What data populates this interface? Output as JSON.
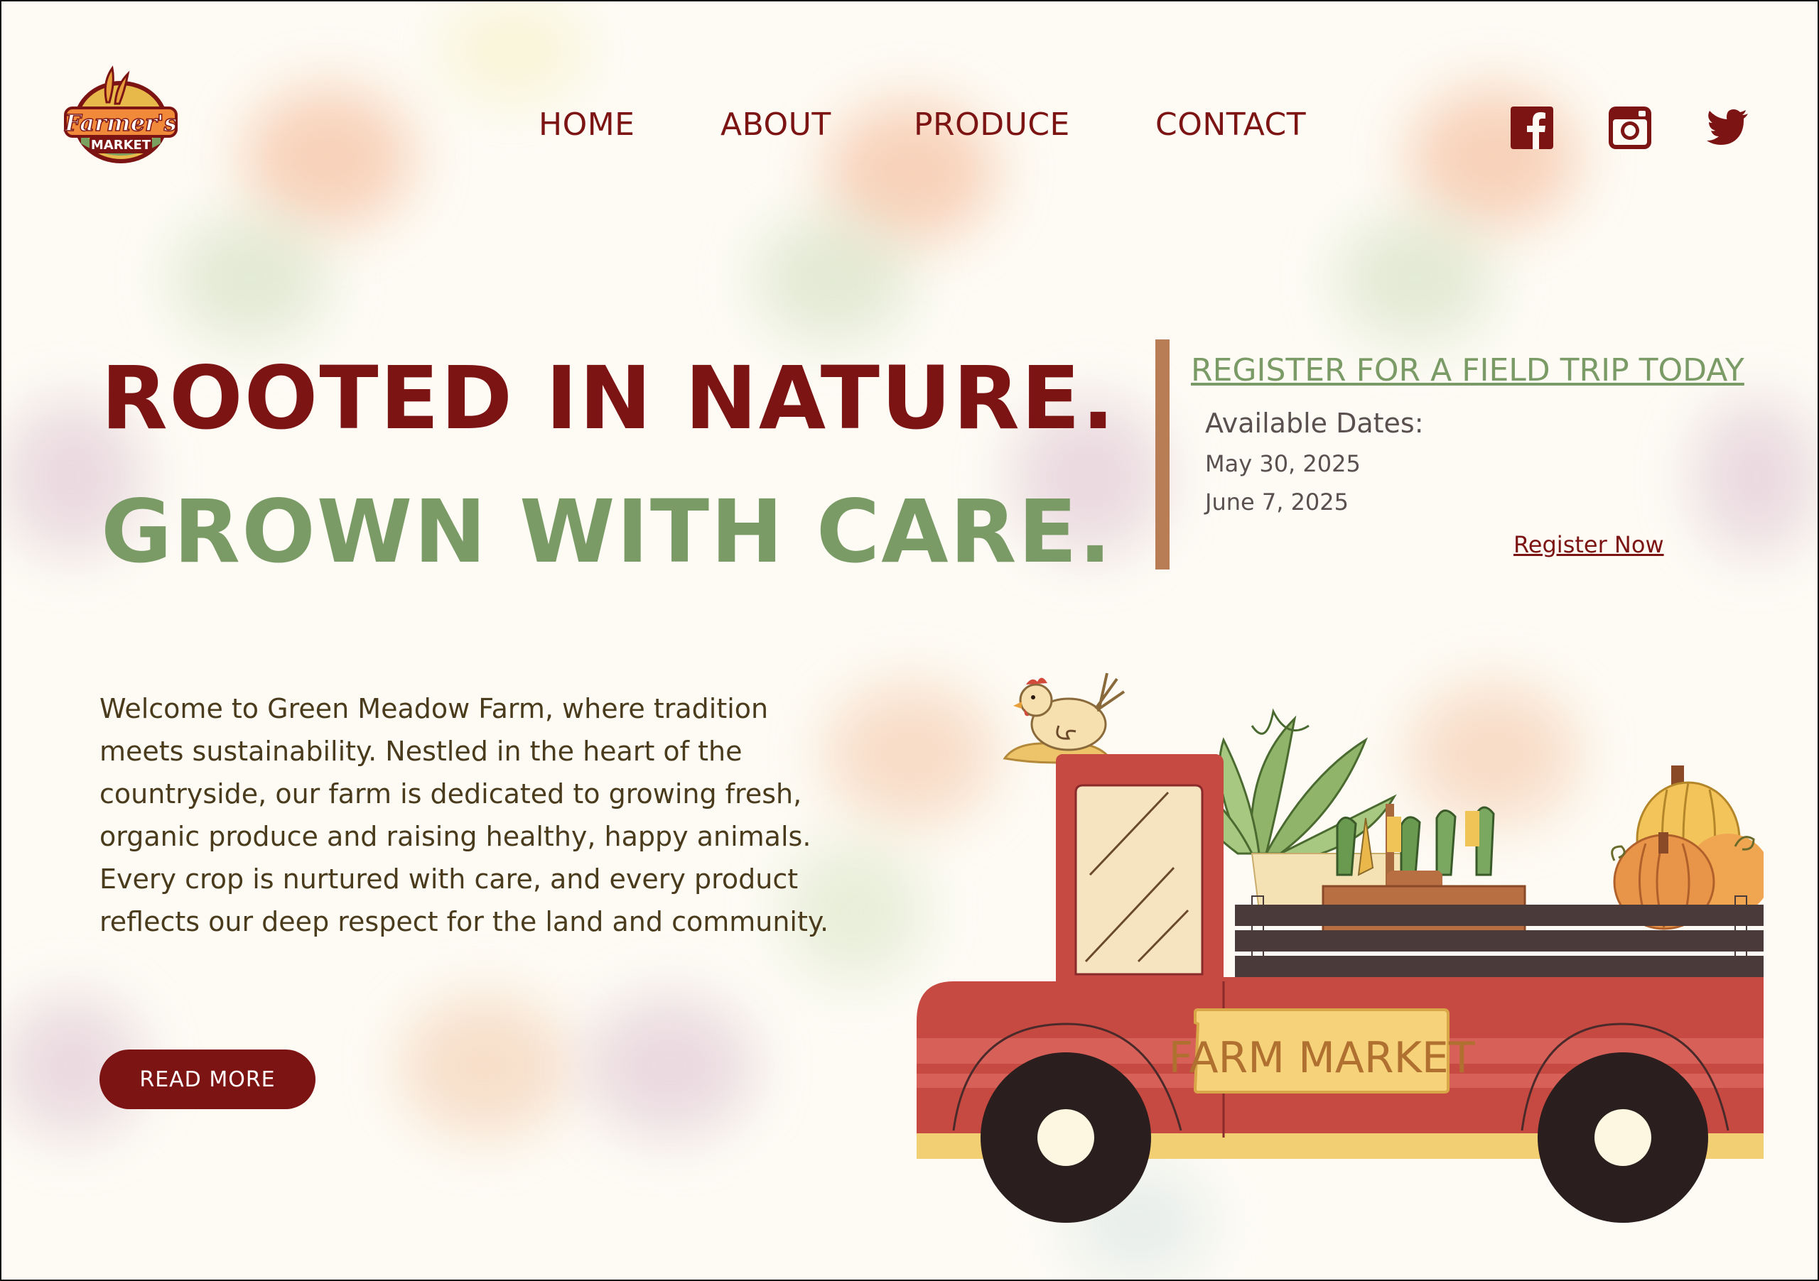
{
  "logo": {
    "text": "Farmer's",
    "subtext": "MARKET",
    "icon": "wheat-logo-icon"
  },
  "nav": {
    "items": [
      {
        "label": "HOME"
      },
      {
        "label": "ABOUT"
      },
      {
        "label": "PRODUCE"
      },
      {
        "label": "CONTACT"
      }
    ]
  },
  "social": [
    {
      "icon": "facebook-icon"
    },
    {
      "icon": "instagram-icon"
    },
    {
      "icon": "twitter-icon"
    }
  ],
  "hero": {
    "line1": "ROOTED IN NATURE.",
    "line2": "GROWN WITH CARE.",
    "intro": "Welcome to Green Meadow Farm, where tradition meets sustainability. Nestled in the heart of the countryside, our farm is dedicated to growing fresh, organic produce and raising healthy, happy animals. Every crop is nurtured with care, and every product reflects our deep respect for the land and community.",
    "button": "READ MORE"
  },
  "field_trip": {
    "title": "REGISTER FOR A FIELD TRIP TODAY",
    "label": "Available Dates:",
    "dates": [
      "May 30, 2025",
      "June 7, 2025"
    ],
    "register": "Register Now"
  },
  "illustration": {
    "sign": "FARM MARKET"
  },
  "colors": {
    "maroon": "#7d1414",
    "green": "#7a9a66",
    "accent_bar": "#b97d55",
    "truck_red": "#c64a42",
    "sign_yellow": "#f4cf6e"
  }
}
